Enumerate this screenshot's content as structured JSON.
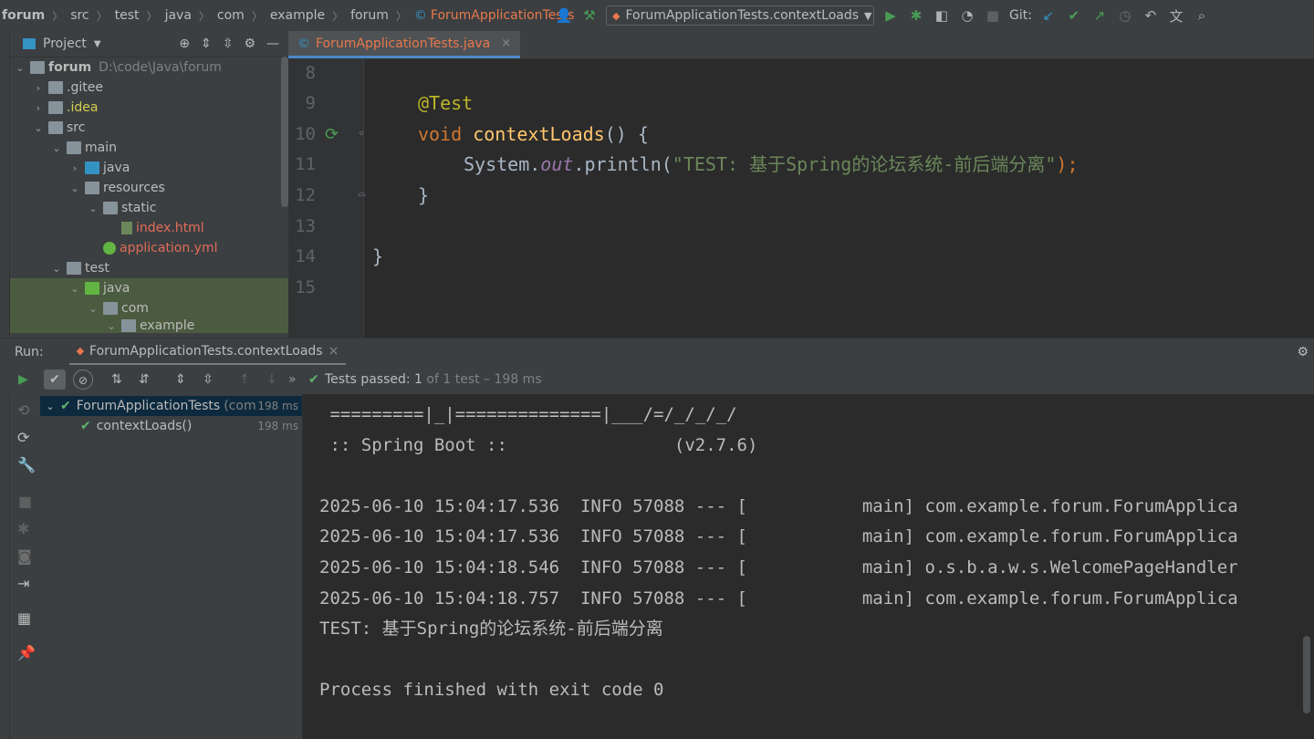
{
  "breadcrumb": {
    "items": [
      "forum",
      "src",
      "test",
      "java",
      "com",
      "example",
      "forum"
    ],
    "file": "ForumApplicationTests"
  },
  "toolbar": {
    "run_config": "ForumApplicationTests.contextLoads",
    "git_label": "Git:"
  },
  "project_panel": {
    "title": "Project",
    "tree": [
      {
        "label": "forum",
        "extra": "D:\\code\\Java\\forum"
      },
      {
        "label": ".gitee"
      },
      {
        "label": ".idea"
      },
      {
        "label": "src"
      },
      {
        "label": "main"
      },
      {
        "label": "java"
      },
      {
        "label": "resources"
      },
      {
        "label": "static"
      },
      {
        "label": "index.html"
      },
      {
        "label": "application.yml"
      },
      {
        "label": "test"
      },
      {
        "label": "java"
      },
      {
        "label": "com"
      },
      {
        "label": "example"
      }
    ]
  },
  "editor": {
    "tab_label": "ForumApplicationTests.java",
    "line_numbers": [
      "8",
      "9",
      "10",
      "11",
      "12",
      "13",
      "14",
      "15"
    ],
    "code": {
      "annotation": "@Test",
      "void_kw": "void",
      "method": "contextLoads",
      "method_rest": "() {",
      "sys": "System.",
      "out": "out",
      "println": ".println(",
      "string": "\"TEST: 基于Spring的论坛系统-前后端分离\"",
      "close_call": ");",
      "close_brace": "}",
      "class_close": "}"
    }
  },
  "run_panel": {
    "label": "Run:",
    "tab_label": "ForumApplicationTests.contextLoads",
    "status_prefix": "Tests passed:",
    "status_count": "1",
    "status_suffix": "of 1 test – 198 ms",
    "tests": [
      {
        "name": "ForumApplicationTests",
        "hint": "(com",
        "time": "198 ms"
      },
      {
        "name": "contextLoads()",
        "time": "198 ms"
      }
    ],
    "console_lines": [
      " =========|_|==============|___/=/_/_/_/",
      " :: Spring Boot ::                (v2.7.6)",
      "",
      "2025-06-10 15:04:17.536  INFO 57088 --- [           main] com.example.forum.ForumApplica",
      "2025-06-10 15:04:17.536  INFO 57088 --- [           main] com.example.forum.ForumApplica",
      "2025-06-10 15:04:18.546  INFO 57088 --- [           main] o.s.b.a.w.s.WelcomePageHandler",
      "2025-06-10 15:04:18.757  INFO 57088 --- [           main] com.example.forum.ForumApplica",
      "TEST: 基于Spring的论坛系统-前后端分离",
      "",
      "Process finished with exit code 0"
    ]
  }
}
